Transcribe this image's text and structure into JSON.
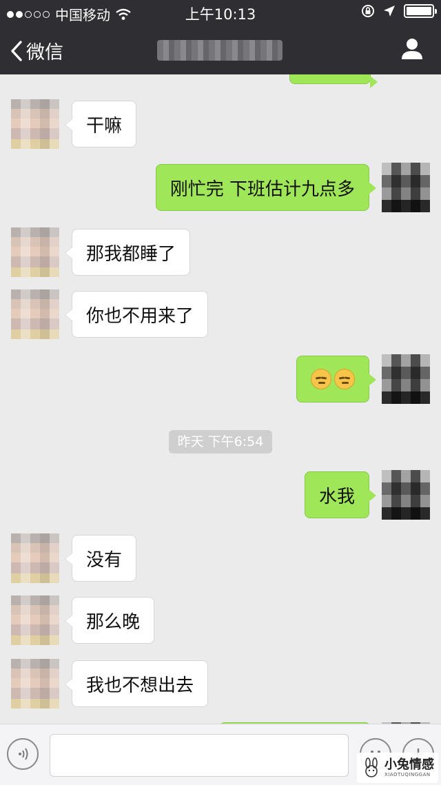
{
  "status_bar": {
    "carrier": "中国移动",
    "time": "上午10:13",
    "signal_dots_filled": 2,
    "signal_dots_total": 5,
    "battery_level": 1.0
  },
  "nav": {
    "back_label": "微信",
    "back_icon": "chevron-left-icon",
    "profile_icon": "person-icon"
  },
  "messages": [
    {
      "side": "in",
      "text": "干嘛"
    },
    {
      "side": "out",
      "text": "刚忙完 下班估计九点多"
    },
    {
      "side": "in",
      "text": "那我都睡了"
    },
    {
      "side": "in",
      "text": "你也不用来了"
    },
    {
      "side": "out",
      "emoji_count": 2,
      "emoji_name": "unamused-face"
    },
    {
      "side": "out",
      "text": "水我"
    },
    {
      "side": "in",
      "text": "没有"
    },
    {
      "side": "in",
      "text": "那么晚"
    },
    {
      "side": "in",
      "text": "我也不想出去"
    }
  ],
  "timestamp": "昨天 下午6:54",
  "input_bar": {
    "text_value": "",
    "voice_icon": "voice-icon",
    "emoji_icon": "emoji-icon",
    "more_icon": "plus-icon"
  },
  "watermark": {
    "text": "小兔情感",
    "sub": "XIAOTUQINGGAN"
  },
  "colors": {
    "header_bg": "#2e2e33",
    "chat_bg": "#ebebeb",
    "bubble_out": "#9fe658",
    "bubble_in": "#ffffff"
  }
}
